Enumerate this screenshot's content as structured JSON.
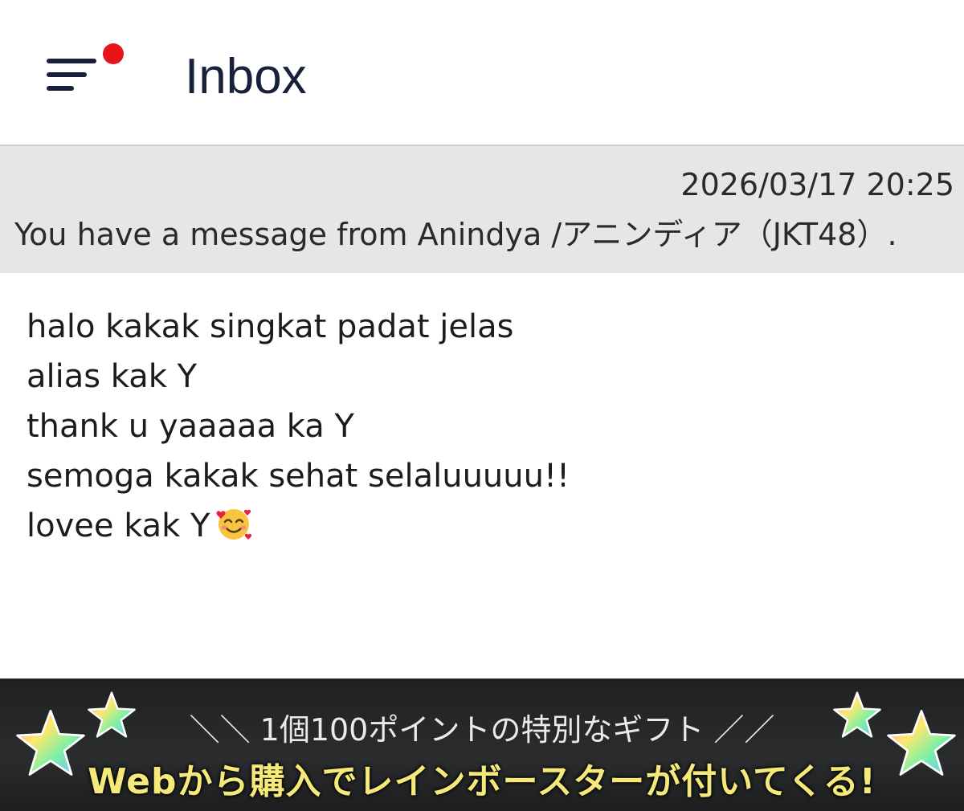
{
  "header": {
    "title": "Inbox",
    "menu_icon": "menu-icon",
    "notification_color": "#e8141b"
  },
  "notice": {
    "date": "2026/03/17 20:25",
    "subject": "You have a message from Anindya /アニンディア（JKT48）."
  },
  "message": {
    "lines": [
      "halo kakak singkat padat jelas",
      "alias kak Y",
      "thank u yaaaaa ka Y",
      "semoga kakak sehat selaluuuuu!!",
      "lovee kak Y"
    ],
    "emoji_icon": "smiling-face-with-hearts-icon"
  },
  "banner": {
    "top_text": "＼＼ 1個100ポイントの特別なギフト ／／",
    "bottom_text": "Webから購入でレインボースターが付いてくる!",
    "accent_color": "#f5e97a",
    "star_icon": "rainbow-star-icon"
  }
}
